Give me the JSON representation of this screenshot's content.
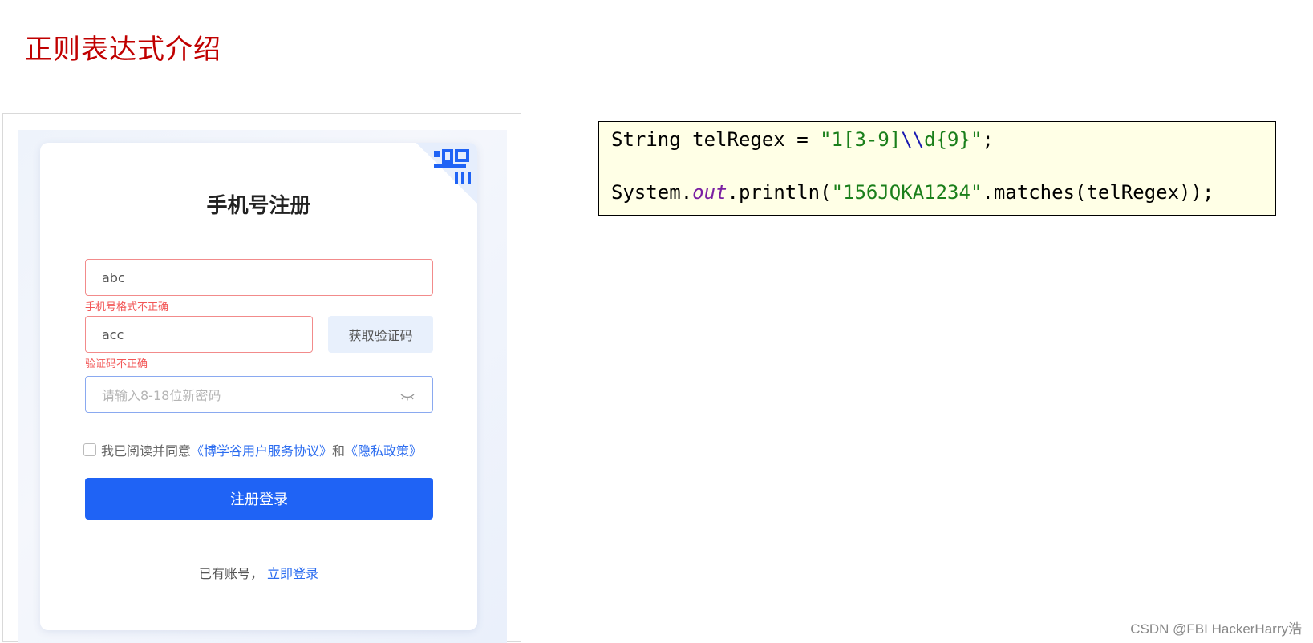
{
  "slide": {
    "title": "正则表达式介绍"
  },
  "register_card": {
    "title": "手机号注册",
    "phone_value": "abc",
    "phone_error": "手机号格式不正确",
    "code_value": "acc",
    "code_button": "获取验证码",
    "code_error": "验证码不正确",
    "password_placeholder": "请输入8-18位新密码",
    "agree_text": "我已阅读并同意",
    "agreement_link": "《博学谷用户服务协议》",
    "agree_and": "和",
    "privacy_link": "《隐私政策》",
    "submit_label": "注册登录",
    "have_account": "已有账号，",
    "login_link": "立即登录",
    "icons": [
      "qr-code-icon",
      "eye-closed-icon",
      "checkbox"
    ]
  },
  "code": {
    "line1": {
      "decl": "String telRegex = ",
      "str_a": "\"1[3-9]",
      "esc": "\\\\",
      "str_b": "d{9}\"",
      "end": ";"
    },
    "line2": {
      "pre": "System.",
      "field": "out",
      "mid": ".println(",
      "str": "\"156JQKA1234\"",
      "end": ".matches(telRegex));"
    }
  },
  "watermark": "CSDN @FBI HackerHarry浩",
  "colors": {
    "title": "#c00000",
    "primary": "#1f63f5",
    "error": "#f25757",
    "code_bg": "#ffffe6",
    "string": "#1a7f1a"
  }
}
